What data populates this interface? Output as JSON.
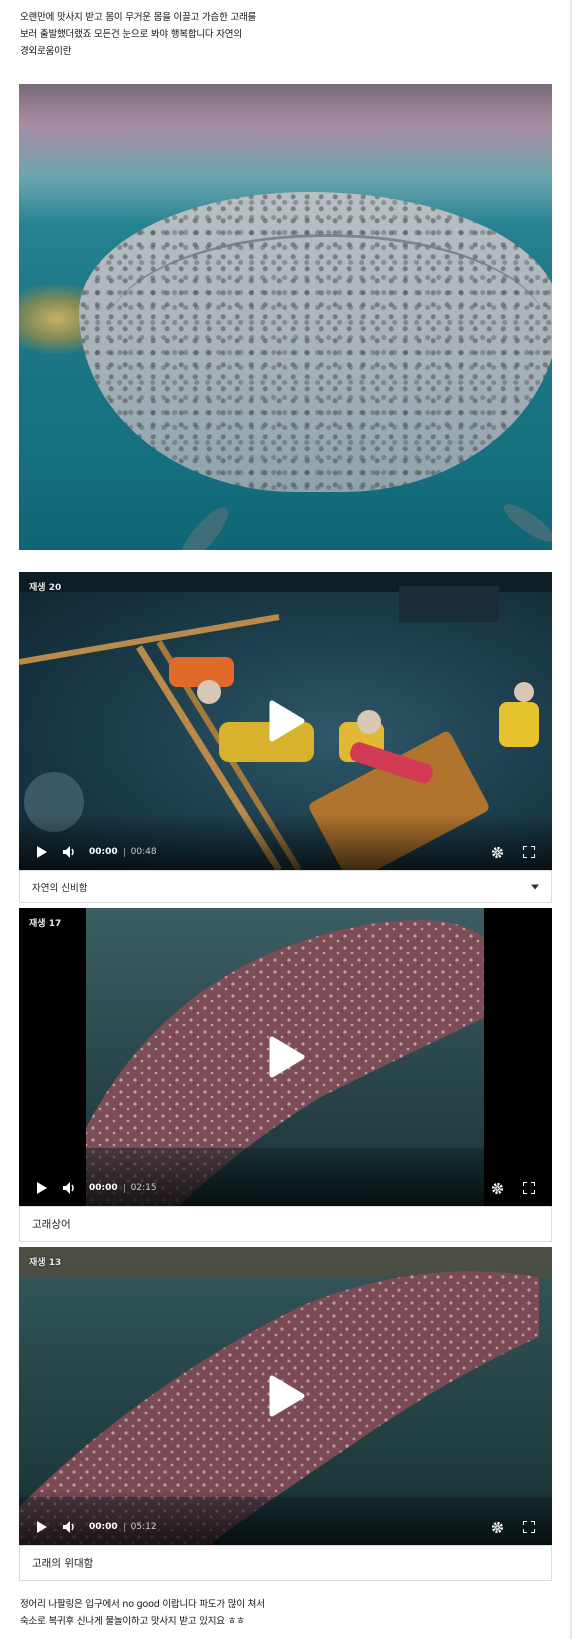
{
  "intro": {
    "lines": [
      "오랜만에 맛사지 받고 몸이 무거운 몸을 이끌고 가슴한 고래를",
      "보러 출발했더랬죠 모든건 눈으로 봐야 행복합니다 자연의",
      "경외로움이란"
    ]
  },
  "videos": [
    {
      "badge": "재생 20",
      "time": "00:00",
      "duration": "00:48",
      "caption": "자연의 신비함",
      "caption_has_dropdown": true
    },
    {
      "badge": "재생 17",
      "time": "00:00",
      "duration": "02:15",
      "caption": "고래상어"
    },
    {
      "badge": "재생 13",
      "time": "00:00",
      "duration": "05:12",
      "caption": "고래의 위대함"
    }
  ],
  "outro": {
    "lines": [
      "정어리 나팔링은 입구에서 no good 이랍니다 파도가 많이 쳐서",
      "숙소로 복귀후 신나게 물놀이하고 맛사지 받고 있지요 ㅎㅎ"
    ]
  },
  "icons": {
    "play": "play-icon",
    "volume": "volume-icon",
    "settings": "gear-icon",
    "fullscreen": "fullscreen-icon",
    "dropdown": "chevron-down-icon"
  }
}
